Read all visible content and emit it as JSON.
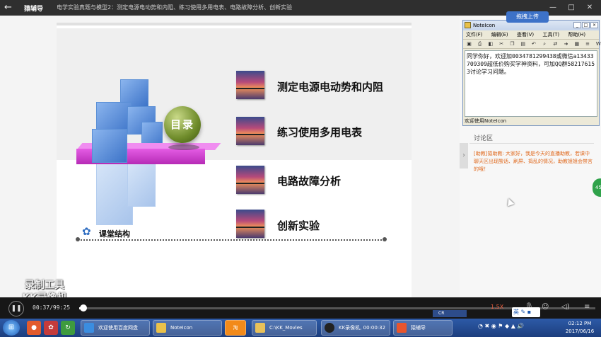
{
  "window": {
    "app_name": "猿辅导",
    "breadcrumb": "电学实验真题与模型2：测定电源电动势和内阻、练习使用多用电表、电路故障分析、创新实验",
    "controls": [
      "—",
      "□",
      "✕"
    ]
  },
  "slide": {
    "badge": "目录",
    "items": [
      {
        "label": "测定电源电动势和内阻"
      },
      {
        "label": "练习使用多用电表"
      },
      {
        "label": "电路故障分析"
      },
      {
        "label": "创新实验"
      }
    ],
    "structure_label": "课堂结构"
  },
  "watermark": {
    "line1": "录制工具",
    "line2": "KK录像机"
  },
  "noteicon": {
    "title": "NoteIcon",
    "menu": [
      "文件(F)",
      "编辑(E)",
      "查看(V)",
      "工具(T)",
      "帮助(H)"
    ],
    "content": "同学你好，欢迎加0034781299438或微信a13433709309超低价购买学神资料，可加QQ群582176153讨论学习问题。",
    "status": "欢迎使用NoteIcon"
  },
  "upload_button": "拖拽上传",
  "discussion": {
    "title": "讨论区",
    "message": "[助教]猿助教: 大家好，我是今天的直播助教，若课中聊天区出现酸话、刷屏、捣乱的情况，助教姐姐会禁言的哦！"
  },
  "player": {
    "current_time": "00:37",
    "total_time": "99:25",
    "progress": 0.006,
    "speed": "1.5X",
    "cr_label": "CR"
  },
  "taskbar": {
    "tasks": [
      {
        "label": "欢迎使用百度网盘",
        "color": "#3b8de0"
      },
      {
        "label": "NoteIcon",
        "color": "#e9c14a"
      },
      {
        "label": "淘",
        "color": "#f28a1a"
      },
      {
        "label": "C:\\KK_Movies",
        "color": "#e8c15a"
      },
      {
        "label": "KK录像机, 00:00:32",
        "color": "#222222"
      },
      {
        "label": "猿辅导",
        "color": "#e8552d"
      }
    ],
    "ime": "英",
    "time": "02:12 PM",
    "date": "2017/06/16"
  }
}
